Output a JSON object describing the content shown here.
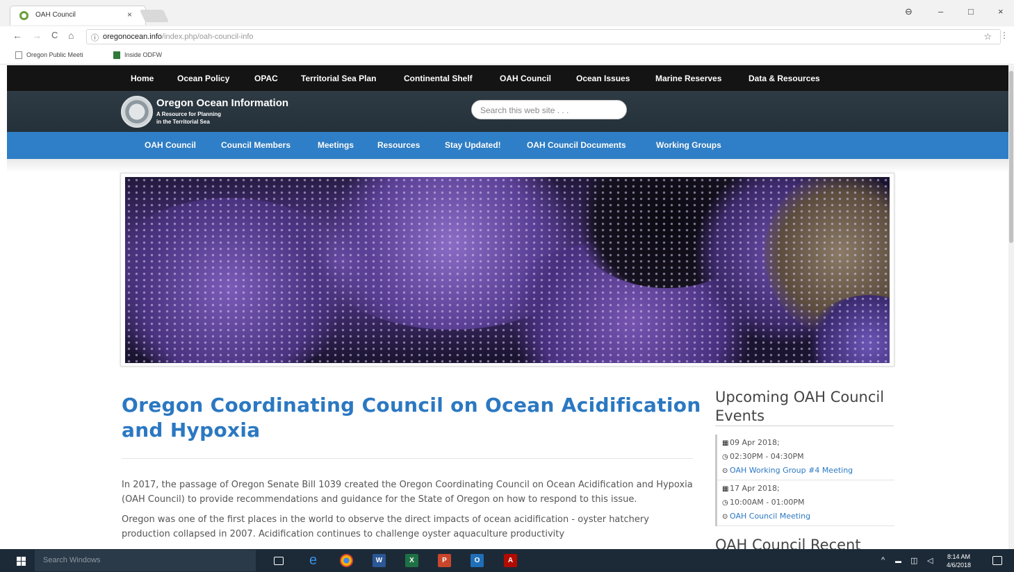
{
  "browser": {
    "tab_title": "OAH Council",
    "tab_close": "×",
    "window_controls": {
      "account": "⊖",
      "minimize": "–",
      "maximize": "□",
      "close": "×"
    },
    "nav": {
      "back": "←",
      "forward": "→",
      "reload": "C",
      "home": "⌂"
    },
    "url_host": "oregonocean.info",
    "url_path": "/index.php/oah-council-info",
    "bookmarks": [
      "Oregon Public Meeti",
      "Inside ODFW"
    ]
  },
  "site": {
    "top_nav": [
      "Home",
      "Ocean Policy",
      "OPAC",
      "Territorial Sea Plan",
      "Continental Shelf",
      "OAH Council",
      "Ocean Issues",
      "Marine Reserves",
      "Data & Resources"
    ],
    "site_name": "Oregon Ocean Information",
    "site_tagline_1": "A Resource for Planning",
    "site_tagline_2": "in the Territorial Sea",
    "search_placeholder": "Search this web site . . .",
    "sub_nav": [
      "OAH Council",
      "Council Members",
      "Meetings",
      "Resources",
      "Stay Updated!",
      "OAH Council Documents",
      "Working Groups"
    ],
    "page_title": "Oregon Coordinating Council on Ocean Acidification and Hypoxia",
    "paragraphs": [
      "In 2017, the passage of Oregon Senate Bill 1039 created the Oregon Coordinating Council on Ocean Acidification and Hypoxia (OAH Council) to provide recommendations and guidance for the State of Oregon on how to respond to this issue.",
      "Oregon was one of the first places in the world to observe the direct impacts of ocean acidification - oyster hatchery production collapsed in 2007. Acidification continues to challenge oyster aquaculture productivity"
    ],
    "sidebar": {
      "events_title": "Upcoming OAH Council Events",
      "events": [
        {
          "date": "09 Apr 2018;",
          "time": "02:30PM - 04:30PM",
          "title": "OAH Working Group #4 Meeting"
        },
        {
          "date": "17 Apr 2018;",
          "time": "10:00AM - 01:00PM",
          "title": "OAH Council Meeting"
        }
      ],
      "recent_title": "OAH Council Recent"
    }
  },
  "taskbar": {
    "search_placeholder": "Search Windows",
    "clock_time": "8:14 AM",
    "clock_date": "4/6/2018"
  },
  "colors": {
    "top_nav_bg": "#141414",
    "banner_bg": "#2f3b44",
    "sub_nav_bg": "#2e7fc7",
    "link": "#2b78c2",
    "taskbar_bg": "#1c2a38"
  }
}
